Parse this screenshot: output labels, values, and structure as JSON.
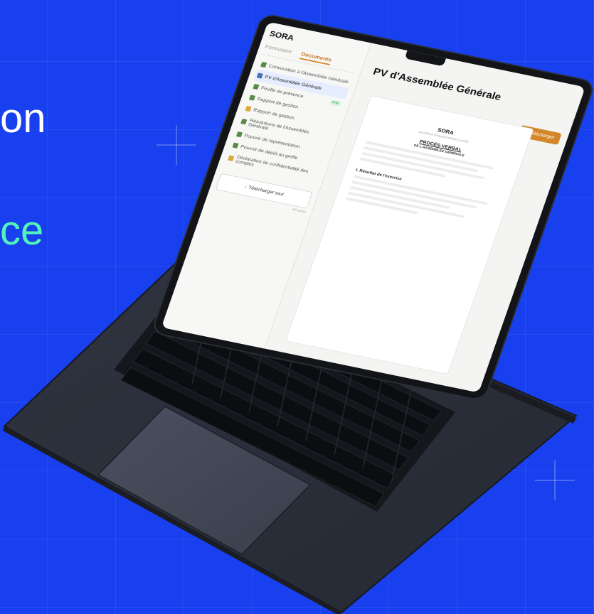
{
  "hero": {
    "line1": "on",
    "line2": "ce"
  },
  "app": {
    "brand": "SORA",
    "tabs": [
      {
        "label": "Formulaire",
        "active": false
      },
      {
        "label": "Documents",
        "active": true
      }
    ],
    "documents": [
      {
        "label": "Convocation à l'Assemblée Générale",
        "icon": "document-icon",
        "active": false
      },
      {
        "label": "PV d'Assemblée Générale",
        "icon": "document-icon",
        "active": true
      },
      {
        "label": "Feuille de présence",
        "icon": "document-icon",
        "active": false,
        "badge": "Prêt"
      },
      {
        "label": "Rapport de gestion",
        "icon": "document-icon",
        "active": false
      },
      {
        "label": "Rapport de gestion",
        "icon": "document-icon",
        "active": false
      },
      {
        "label": "Résolutions de l'Assemblée Générale",
        "icon": "document-icon",
        "active": false
      },
      {
        "label": "Pouvoir de représentation",
        "icon": "document-icon",
        "active": false
      },
      {
        "label": "Pouvoir de dépôt au greffe",
        "icon": "document-icon",
        "active": false
      },
      {
        "label": "Déclaration de confidentialité des comptes",
        "icon": "document-icon",
        "active": false
      }
    ],
    "download_all": "↓ Télécharger tout",
    "download_count": "9/9 prêts"
  },
  "document": {
    "title": "PV d'Assemblée Générale",
    "download_button": "↓ Télécharger",
    "org_name": "SORA",
    "org_subtitle": "Société à Responsabilité Limitée",
    "heading1": "PROCÈS-VERBAL",
    "heading2": "DE L'ASSEMBLÉE GÉNÉRALE",
    "section": "I. Résultat de l'exercice"
  },
  "colors": {
    "background": "#1840ee",
    "accent_text": "#52f5b6",
    "button": "#d4872a"
  }
}
